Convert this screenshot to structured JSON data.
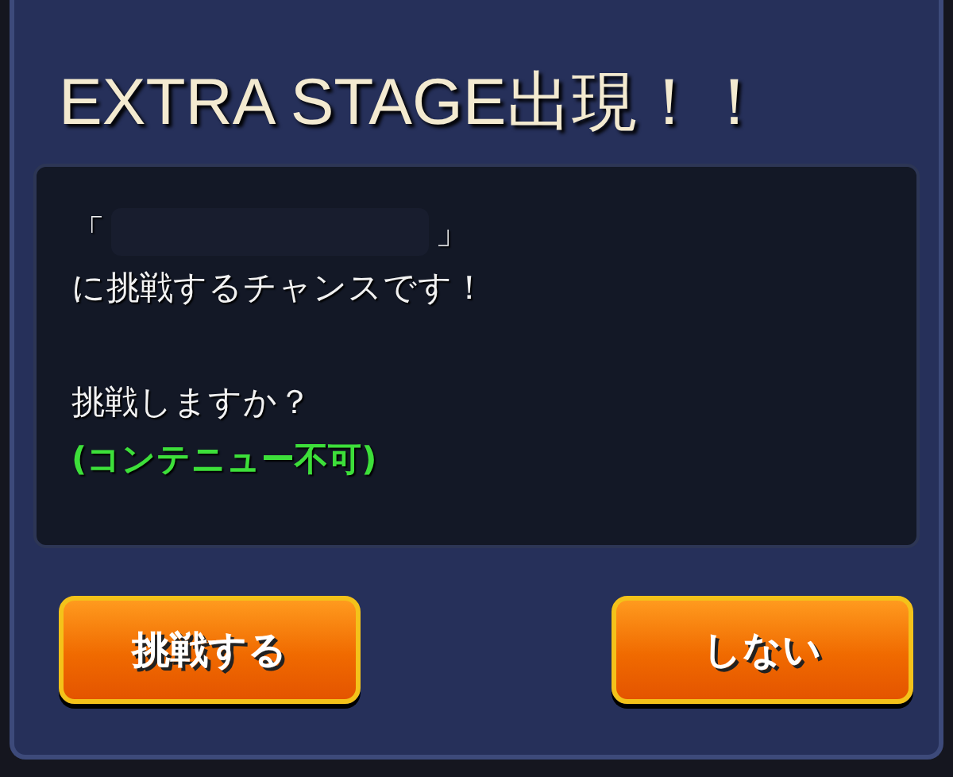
{
  "dialog": {
    "title": "EXTRA STAGE出現！！",
    "message": {
      "open_bracket": "「",
      "close_bracket": "」",
      "line_1": "に挑戦するチャンスです！",
      "line_2": "挑戦しますか？",
      "note": "(コンテニュー不可)"
    },
    "buttons": [
      {
        "label": "挑戦する"
      },
      {
        "label": "しない"
      }
    ]
  }
}
